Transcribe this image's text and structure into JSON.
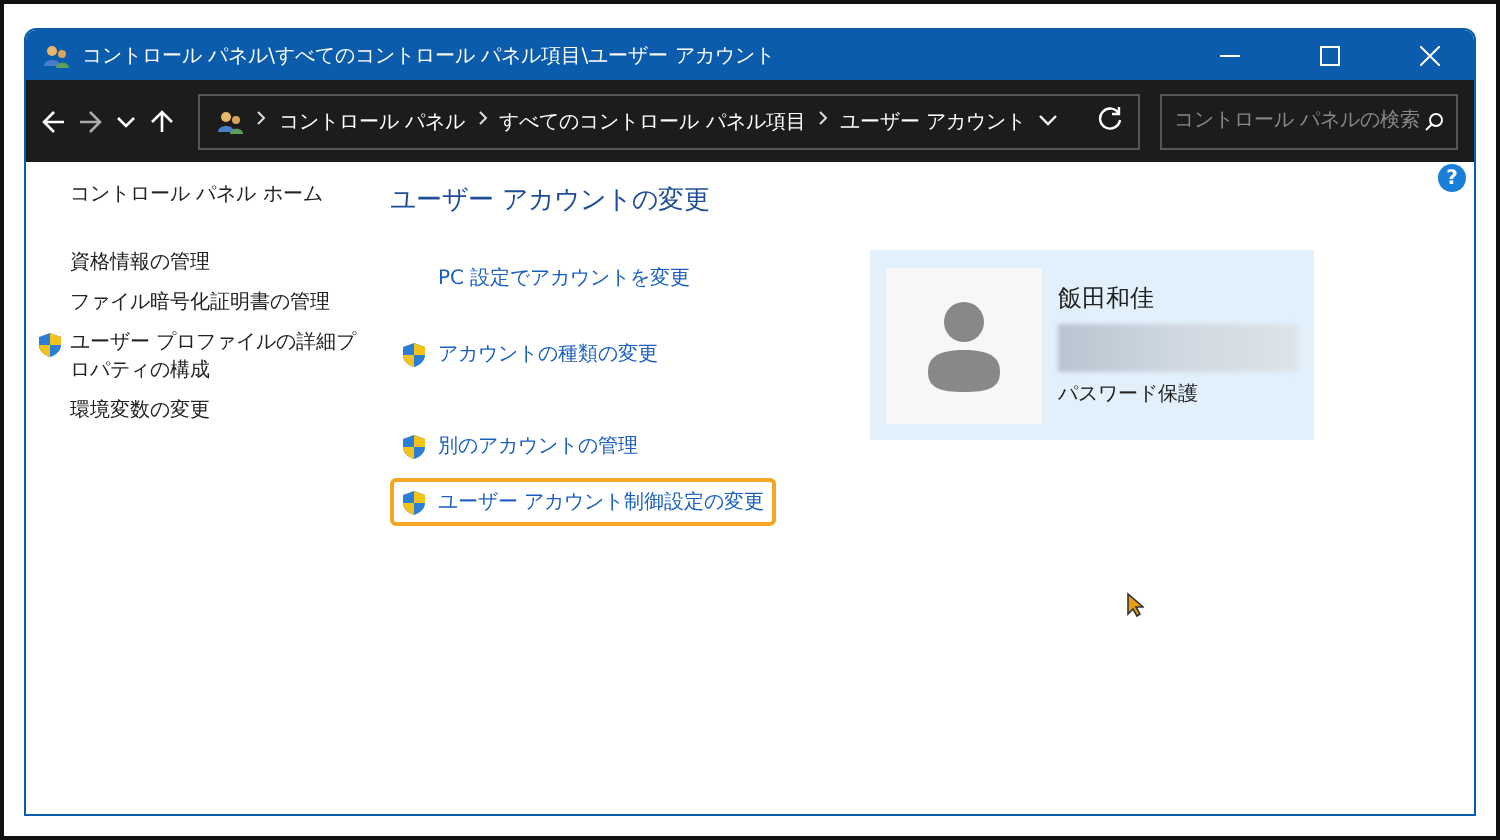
{
  "window": {
    "title": "コントロール パネル\\すべてのコントロール パネル項目\\ユーザー アカウント"
  },
  "breadcrumb": [
    "コントロール パネル",
    "すべてのコントロール パネル項目",
    "ユーザー アカウント"
  ],
  "search": {
    "placeholder": "コントロール パネルの検索"
  },
  "help": "?",
  "sidebar": {
    "home": "コントロール パネル ホーム",
    "items": [
      {
        "label": "資格情報の管理",
        "shield": false
      },
      {
        "label": "ファイル暗号化証明書の管理",
        "shield": false
      },
      {
        "label": "ユーザー プロファイルの詳細プロパティの構成",
        "shield": true
      },
      {
        "label": "環境変数の変更",
        "shield": false
      }
    ]
  },
  "main": {
    "heading": "ユーザー アカウントの変更",
    "link_groups": [
      [
        {
          "label": "PC 設定でアカウントを変更",
          "shield": false,
          "highlighted": false
        },
        {
          "label": "アカウントの種類の変更",
          "shield": true,
          "highlighted": false
        }
      ],
      [
        {
          "label": "別のアカウントの管理",
          "shield": true,
          "highlighted": false
        },
        {
          "label": "ユーザー アカウント制御設定の変更",
          "shield": true,
          "highlighted": true
        }
      ]
    ]
  },
  "user": {
    "name": "飯田和佳",
    "status": "パスワード保護"
  }
}
